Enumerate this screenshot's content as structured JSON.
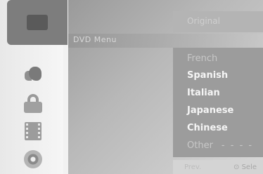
{
  "header": {
    "original_label": "Original"
  },
  "menu": {
    "title": "DVD Menu"
  },
  "sidebar": {
    "items": [
      {
        "icon": "disc-setup-icon",
        "active": true
      },
      {
        "icon": "audio-icon",
        "active": false
      },
      {
        "icon": "lock-icon",
        "active": false
      },
      {
        "icon": "film-icon",
        "active": false
      },
      {
        "icon": "cd-icon",
        "active": false
      }
    ]
  },
  "languages": {
    "items": [
      {
        "label": "French",
        "dim": true
      },
      {
        "label": "Spanish",
        "dim": false
      },
      {
        "label": "Italian",
        "dim": false
      },
      {
        "label": "Japanese",
        "dim": false
      },
      {
        "label": "Chinese",
        "dim": false
      },
      {
        "label": "Other",
        "dim": true,
        "value": "- - - -"
      }
    ]
  },
  "footer": {
    "prev_label": "Prev.",
    "select_label": "Sele"
  }
}
